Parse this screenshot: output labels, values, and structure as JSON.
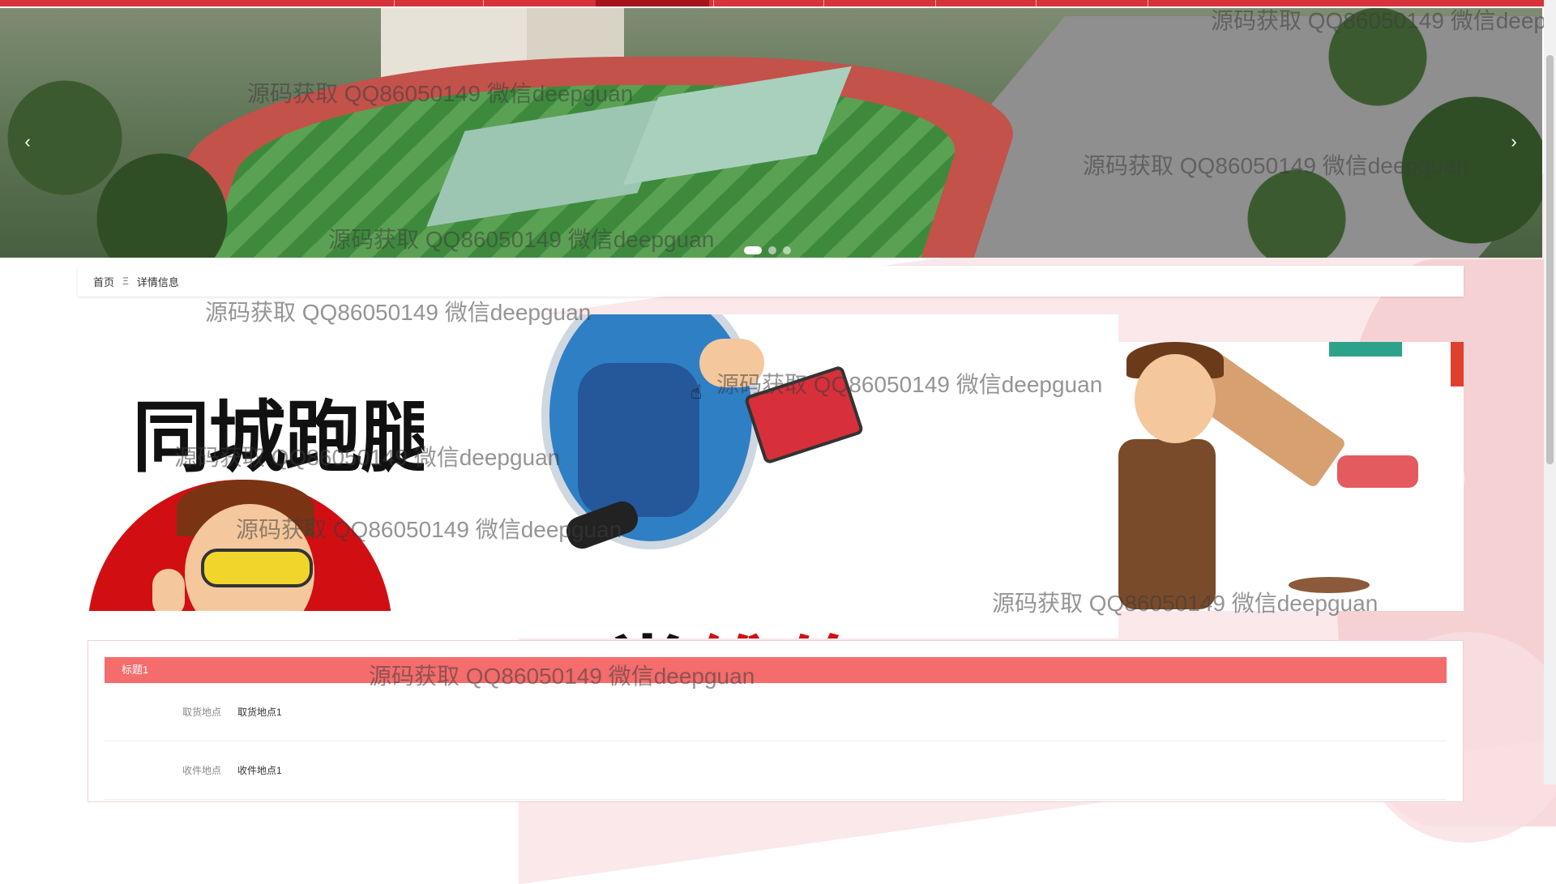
{
  "breadcrumb": {
    "home": "首页",
    "separator": "Ξ",
    "current": "详情信息"
  },
  "gallery": {
    "left_slide_text": "同城跑腿",
    "center_slide_text_black": "日常",
    "center_slide_text_red": "维修",
    "prev_icon": "‹",
    "next_icon": "›"
  },
  "banner": {
    "prev_icon": "‹",
    "next_icon": "›",
    "slide_count": 3,
    "active_slide": 1
  },
  "detail": {
    "title": "标题1",
    "fields": [
      {
        "label": "取货地点",
        "value": "取货地点1"
      },
      {
        "label": "收件地点",
        "value": "收件地点1"
      }
    ]
  },
  "watermark": {
    "text": "源码获取 QQ86050149 微信deepguan"
  },
  "colors": {
    "nav": "#d8333b",
    "accent": "#f56c6c",
    "background_shape": "#f7d6d8"
  }
}
